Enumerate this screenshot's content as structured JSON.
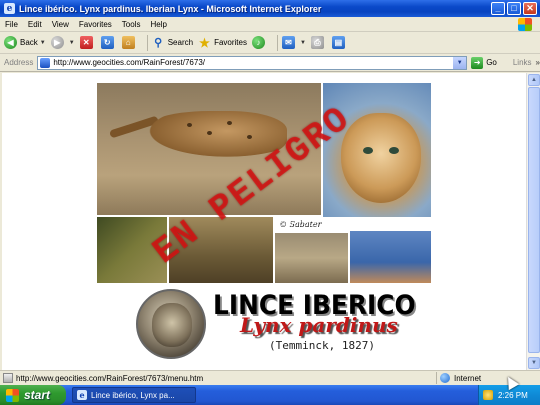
{
  "window": {
    "title": "Lince ibérico. Lynx pardinus. Iberian Lynx - Microsoft Internet Explorer",
    "app_icon": "ie-icon",
    "buttons": {
      "minimize": "_",
      "maximize": "□",
      "close": "✕"
    }
  },
  "menu": {
    "items": [
      "File",
      "Edit",
      "View",
      "Favorites",
      "Tools",
      "Help"
    ]
  },
  "toolbar": {
    "back_label": "Back",
    "search_label": "Search",
    "favorites_label": "Favorites"
  },
  "address": {
    "label": "Address",
    "url": "http://www.geocities.com/RainForest/7673/",
    "go_label": "Go",
    "links_label": "Links"
  },
  "page": {
    "stamp_text": "EN PELIGRO",
    "photo_credit": "© Sabater",
    "main_title": "LINCE IBERICO",
    "scientific_name": "Lynx pardinus",
    "author": "(Temminck, 1827)"
  },
  "status": {
    "message": "http://www.geocities.com/RainForest/7673/menu.htm",
    "zone": "Internet"
  },
  "taskbar": {
    "start_label": "start",
    "task_label": "Lince ibérico, Lynx pa...",
    "clock": "2:26 PM"
  },
  "colors": {
    "titlebar_blue": "#0a49c9",
    "stamp_red": "#d71414",
    "scientific_name_red": "#c01818",
    "start_green": "#2f9a2f"
  }
}
